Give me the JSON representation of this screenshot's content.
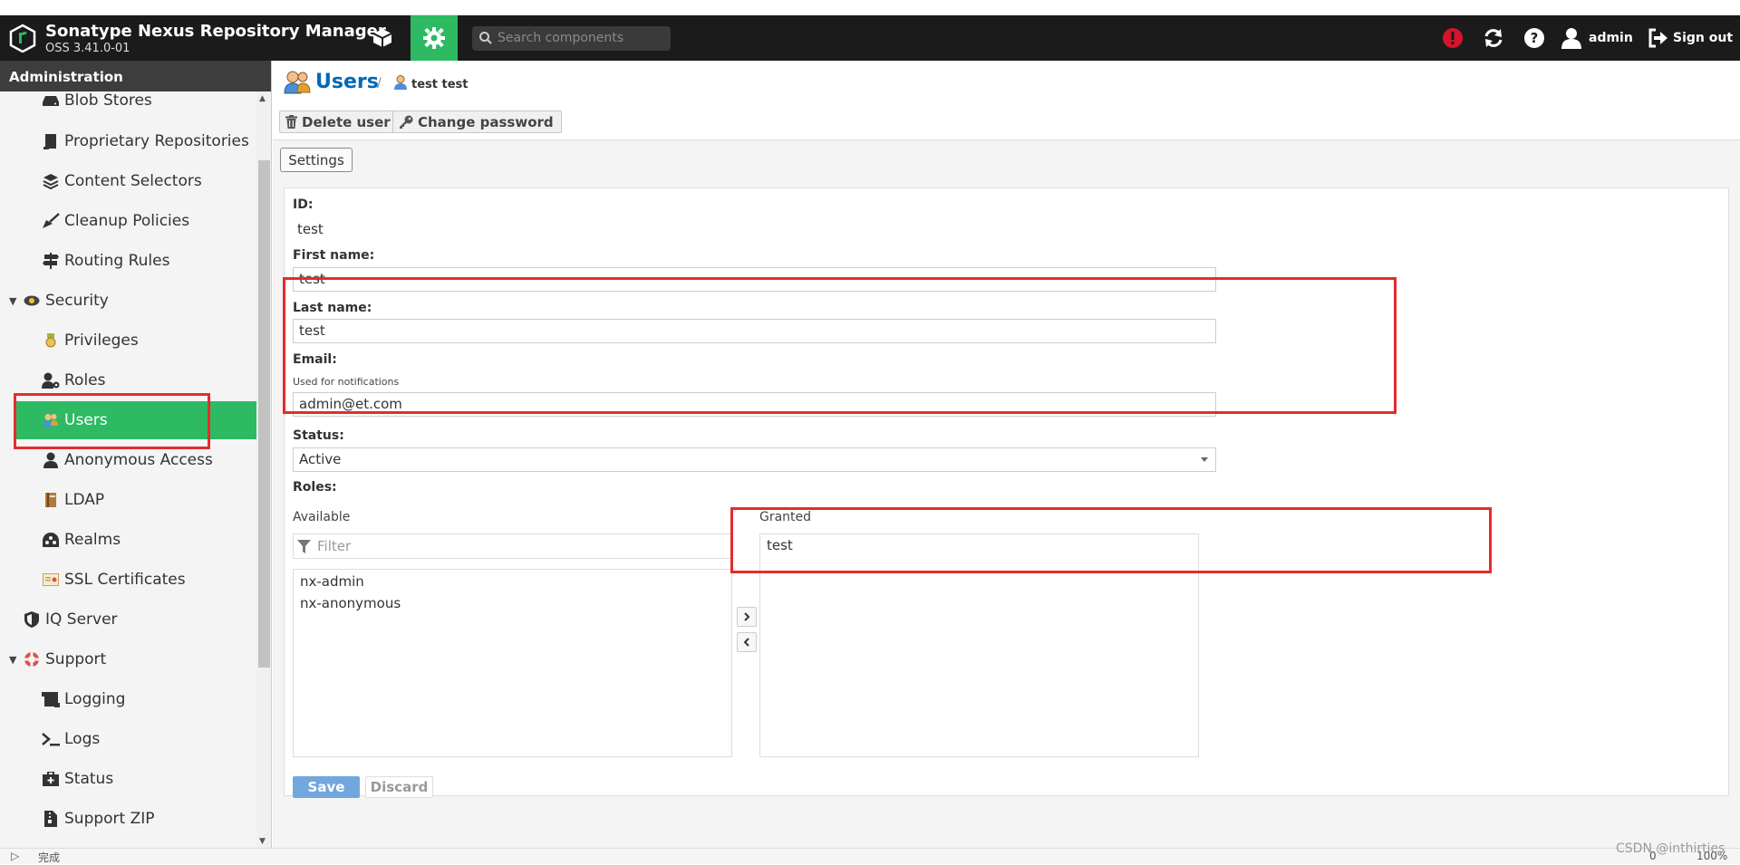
{
  "header": {
    "product_name": "Sonatype Nexus Repository Manager",
    "version": "OSS 3.41.0-01",
    "search_placeholder": "Search components",
    "user_label": "admin",
    "signout_label": "Sign out",
    "accent": "#2dba63"
  },
  "sidebar": {
    "title": "Administration",
    "items": [
      {
        "label": "Blob Stores",
        "icon": "hdd-icon"
      },
      {
        "label": "Proprietary Repositories",
        "icon": "proprietary-icon"
      },
      {
        "label": "Content Selectors",
        "icon": "layers-icon"
      },
      {
        "label": "Cleanup Policies",
        "icon": "broom-icon"
      },
      {
        "label": "Routing Rules",
        "icon": "signpost-icon"
      },
      {
        "label": "Security",
        "icon": "eye-icon"
      },
      {
        "label": "Privileges",
        "icon": "medal-icon"
      },
      {
        "label": "Roles",
        "icon": "user-gear-icon"
      },
      {
        "label": "Users",
        "icon": "users-icon"
      },
      {
        "label": "Anonymous Access",
        "icon": "user-icon"
      },
      {
        "label": "LDAP",
        "icon": "book-icon"
      },
      {
        "label": "Realms",
        "icon": "realm-icon"
      },
      {
        "label": "SSL Certificates",
        "icon": "certificate-icon"
      },
      {
        "label": "IQ Server",
        "icon": "shield-icon"
      },
      {
        "label": "Support",
        "icon": "lifebuoy-icon"
      },
      {
        "label": "Logging",
        "icon": "logging-icon"
      },
      {
        "label": "Logs",
        "icon": "terminal-icon"
      },
      {
        "label": "Status",
        "icon": "medkit-icon"
      },
      {
        "label": "Support ZIP",
        "icon": "zip-file-icon"
      }
    ]
  },
  "breadcrumb": {
    "section": "Users",
    "separator": "/",
    "current": "test test"
  },
  "toolbar": {
    "delete_label": "Delete user",
    "change_password_label": "Change password"
  },
  "tab": {
    "settings_label": "Settings"
  },
  "form": {
    "id_label": "ID:",
    "id_value": "test",
    "first_name_label": "First name:",
    "first_name_value": "test",
    "last_name_label": "Last name:",
    "last_name_value": "test",
    "email_label": "Email:",
    "email_help": "Used for notifications",
    "email_value": "admin@et.com",
    "status_label": "Status:",
    "status_value": "Active",
    "roles_label": "Roles:",
    "available_label": "Available",
    "granted_label": "Granted",
    "filter_placeholder": "Filter",
    "available_roles": [
      "nx-admin",
      "nx-anonymous"
    ],
    "granted_roles": [
      "test"
    ],
    "save_label": "Save",
    "discard_label": "Discard"
  },
  "statusbar": {
    "left_text": "完成",
    "count": "0",
    "zoom": "100%"
  },
  "watermark": "CSDN @inthirties"
}
